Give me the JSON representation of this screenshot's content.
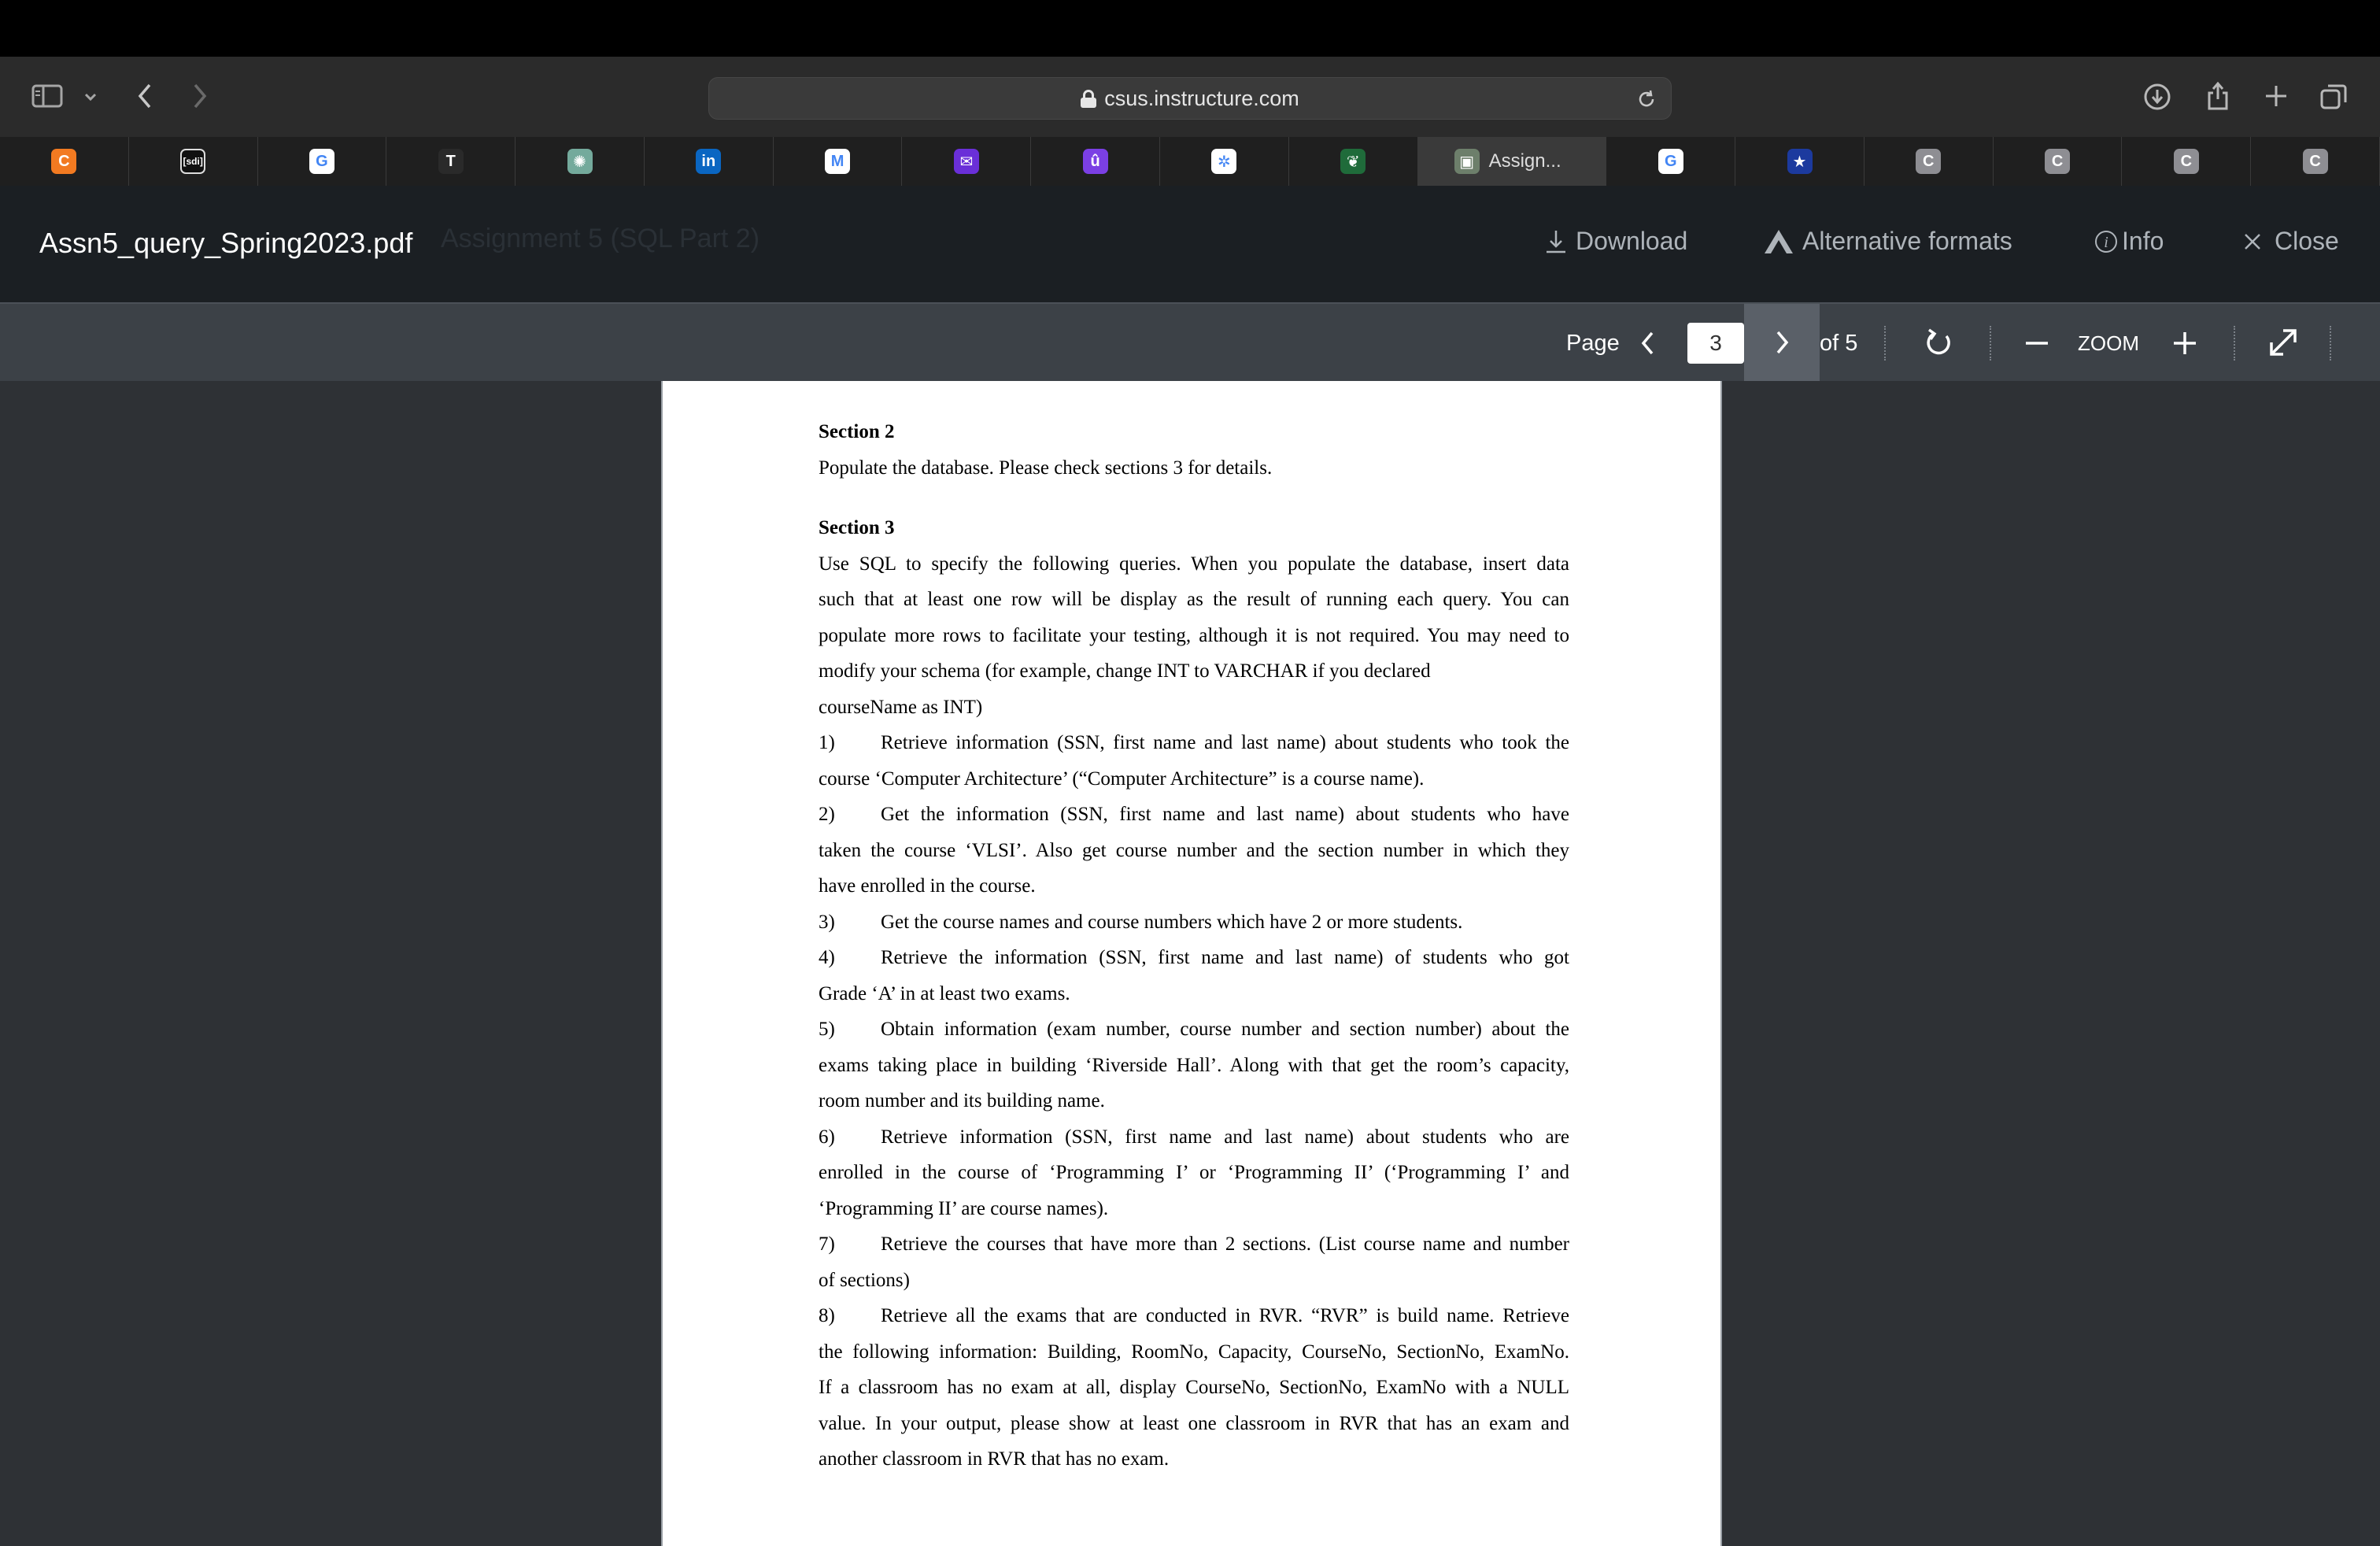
{
  "browser": {
    "url": "csus.instructure.com",
    "tabs": [
      {
        "label": "",
        "favicon": "C",
        "color": "#f27a21"
      },
      {
        "label": "",
        "favicon": "[sdi]",
        "color": "#111111"
      },
      {
        "label": "",
        "favicon": "G",
        "color": "#ffffff"
      },
      {
        "label": "",
        "favicon": "T",
        "color": "#2a2a2a"
      },
      {
        "label": "",
        "favicon": "✺",
        "color": "#74aa9c"
      },
      {
        "label": "",
        "favicon": "in",
        "color": "#0a66c2"
      },
      {
        "label": "",
        "favicon": "M",
        "color": "#ffffff"
      },
      {
        "label": "",
        "favicon": "✉",
        "color": "#6a2fd8"
      },
      {
        "label": "",
        "favicon": "û",
        "color": "#7b3fe4"
      },
      {
        "label": "",
        "favicon": "✲",
        "color": "#ffffff"
      },
      {
        "label": "",
        "favicon": "❦",
        "color": "#1f6b3a"
      },
      {
        "label": "Assign...",
        "favicon": "▣",
        "color": "#6d7f6b",
        "active": true
      },
      {
        "label": "",
        "favicon": "G",
        "color": "#ffffff"
      },
      {
        "label": "",
        "favicon": "★",
        "color": "#1c3a9e"
      },
      {
        "label": "",
        "favicon": "C",
        "color": "#8e8e93"
      },
      {
        "label": "",
        "favicon": "C",
        "color": "#8e8e93"
      },
      {
        "label": "",
        "favicon": "C",
        "color": "#8e8e93"
      },
      {
        "label": "",
        "favicon": "C",
        "color": "#8e8e93"
      }
    ]
  },
  "viewer_header": {
    "title": "Assn5_query_Spring2023.pdf",
    "ghost_breadcrumb": "Assignment 5 (SQL Part 2)",
    "download": "Download",
    "alternative_formats": "Alternative formats",
    "info": "Info",
    "close": "Close"
  },
  "pdf_controls": {
    "page_label": "Page",
    "current_page": "3",
    "total_pages": "of 5",
    "zoom_label": "ZOOM"
  },
  "document": {
    "section2_title": "Section 2",
    "section2_text": "Populate the database. Please check sections 3 for details.",
    "section3_title": "Section 3",
    "intro_lines": [
      "Use SQL to specify the following queries.   When you populate the database, insert data",
      "such that at least one row will be display as the result of running each query. You can",
      "populate more rows to facilitate your testing, although it is not required.  You may need to",
      "modify your schema (for example, change INT to VARCHAR if you declared",
      "courseName as INT)"
    ],
    "queries": [
      {
        "num": "1)",
        "lines": [
          "Retrieve information (SSN, first name and last name) about students who took the",
          "course ‘Computer Architecture’ (“Computer Architecture” is a course name)."
        ]
      },
      {
        "num": "2)",
        "lines": [
          "Get the information (SSN, first name and last name) about students who have",
          "taken the course ‘VLSI’. Also get course number and the section number in which they",
          "have enrolled in the course."
        ]
      },
      {
        "num": "3)",
        "lines": [
          "Get the course names and course numbers which have 2 or more students."
        ]
      },
      {
        "num": "4)",
        "lines": [
          "Retrieve the information (SSN, first name and last name) of students who got",
          "Grade ‘A’ in at least two exams."
        ]
      },
      {
        "num": "5)",
        "lines": [
          "Obtain information (exam number, course number and section number) about the",
          "exams taking place in building ‘Riverside Hall’. Along with that get the room’s capacity,",
          "room number and its building name."
        ]
      },
      {
        "num": "6)",
        "lines": [
          "Retrieve information (SSN, first name and last name) about students who are",
          "enrolled in the course of ‘Programming I’ or ‘Programming II’ (‘Programming I’ and",
          "‘Programming II’ are course names)."
        ]
      },
      {
        "num": "7)",
        "lines": [
          "Retrieve the courses that have more than 2 sections.  (List course name and number",
          "of sections)"
        ]
      },
      {
        "num": "8)",
        "lines": [
          "Retrieve all the exams that are conducted in RVR.  “RVR” is build name. Retrieve",
          "the following information: Building, RoomNo, Capacity, CourseNo, SectionNo, ExamNo.",
          "If a classroom has no exam at all, display CourseNo, SectionNo, ExamNo with a NULL",
          "value. In your output, please show at least one classroom in RVR that has an exam and",
          "another classroom in RVR that has no exam."
        ]
      }
    ]
  }
}
